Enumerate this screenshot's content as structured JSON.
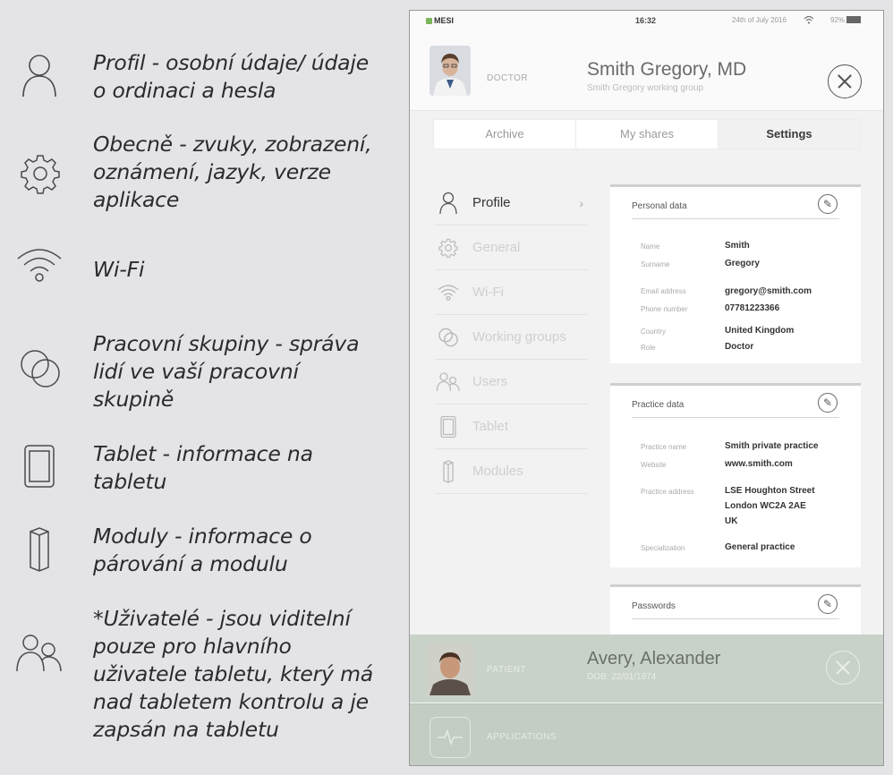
{
  "legend": [
    {
      "icon": "person-icon",
      "text": "Profil - osobní údaje/ údaje o ordinaci a hesla"
    },
    {
      "icon": "gear-icon",
      "text": "Obecně - zvuky, zobrazení, oznámení, jazyk, verze aplikace"
    },
    {
      "icon": "wifi-icon",
      "text": "Wi-Fi"
    },
    {
      "icon": "working-groups-icon",
      "text": "Pracovní skupiny - správa lidí ve vaší pracovní skupině"
    },
    {
      "icon": "tablet-icon",
      "text": "Tablet - informace na tabletu"
    },
    {
      "icon": "module-icon",
      "text": "Moduly - informace o párování a modulu"
    },
    {
      "icon": "users-icon",
      "text": "*Uživatelé - jsou viditelní pouze pro hlavního uživatele tabletu, který má nad tabletem kontrolu a je zapsán na tabletu"
    }
  ],
  "tablet": {
    "status": {
      "brand": "MESI",
      "time": "16:32",
      "date": "24th of July 2016",
      "battery": "92%"
    },
    "doctor": {
      "role": "DOCTOR",
      "name": "Smith Gregory, MD",
      "group": "Smith Gregory working group"
    },
    "tabs": [
      {
        "label": "Archive",
        "active": false
      },
      {
        "label": "My shares",
        "active": false
      },
      {
        "label": "Settings",
        "active": true
      }
    ],
    "menu": [
      {
        "icon": "person-icon",
        "label": "Profile",
        "active": true
      },
      {
        "icon": "gear-icon",
        "label": "General",
        "active": false
      },
      {
        "icon": "wifi-icon",
        "label": "Wi-Fi",
        "active": false
      },
      {
        "icon": "working-groups-icon",
        "label": "Working groups",
        "active": false
      },
      {
        "icon": "users-icon",
        "label": "Users",
        "active": false
      },
      {
        "icon": "tablet-icon",
        "label": "Tablet",
        "active": false
      },
      {
        "icon": "module-icon",
        "label": "Modules",
        "active": false
      }
    ],
    "personal": {
      "title": "Personal data",
      "name_label": "Name",
      "name": "Smith",
      "surname_label": "Surname",
      "surname": "Gregory",
      "email_label": "Email address",
      "email": "gregory@smith.com",
      "phone_label": "Phone number",
      "phone": "07781223366",
      "country_label": "Country",
      "country": "United Kingdom",
      "role_label": "Role",
      "role": "Doctor"
    },
    "practice": {
      "title": "Practice data",
      "name_label": "Practice name",
      "name": "Smith private practice",
      "website_label": "Website",
      "website": "www.smith.com",
      "address_label": "Practice address",
      "address1": "LSE Houghton Street",
      "address2": "London WC2A 2AE",
      "address3": "UK",
      "spec_label": "Specialization",
      "spec": "General practice"
    },
    "passwords": {
      "title": "Passwords"
    },
    "patient": {
      "role": "PATIENT",
      "name": "Avery, Alexander",
      "dob": "DOB: 22/01/1974"
    },
    "app": {
      "label": "APPLICATIONS"
    }
  }
}
